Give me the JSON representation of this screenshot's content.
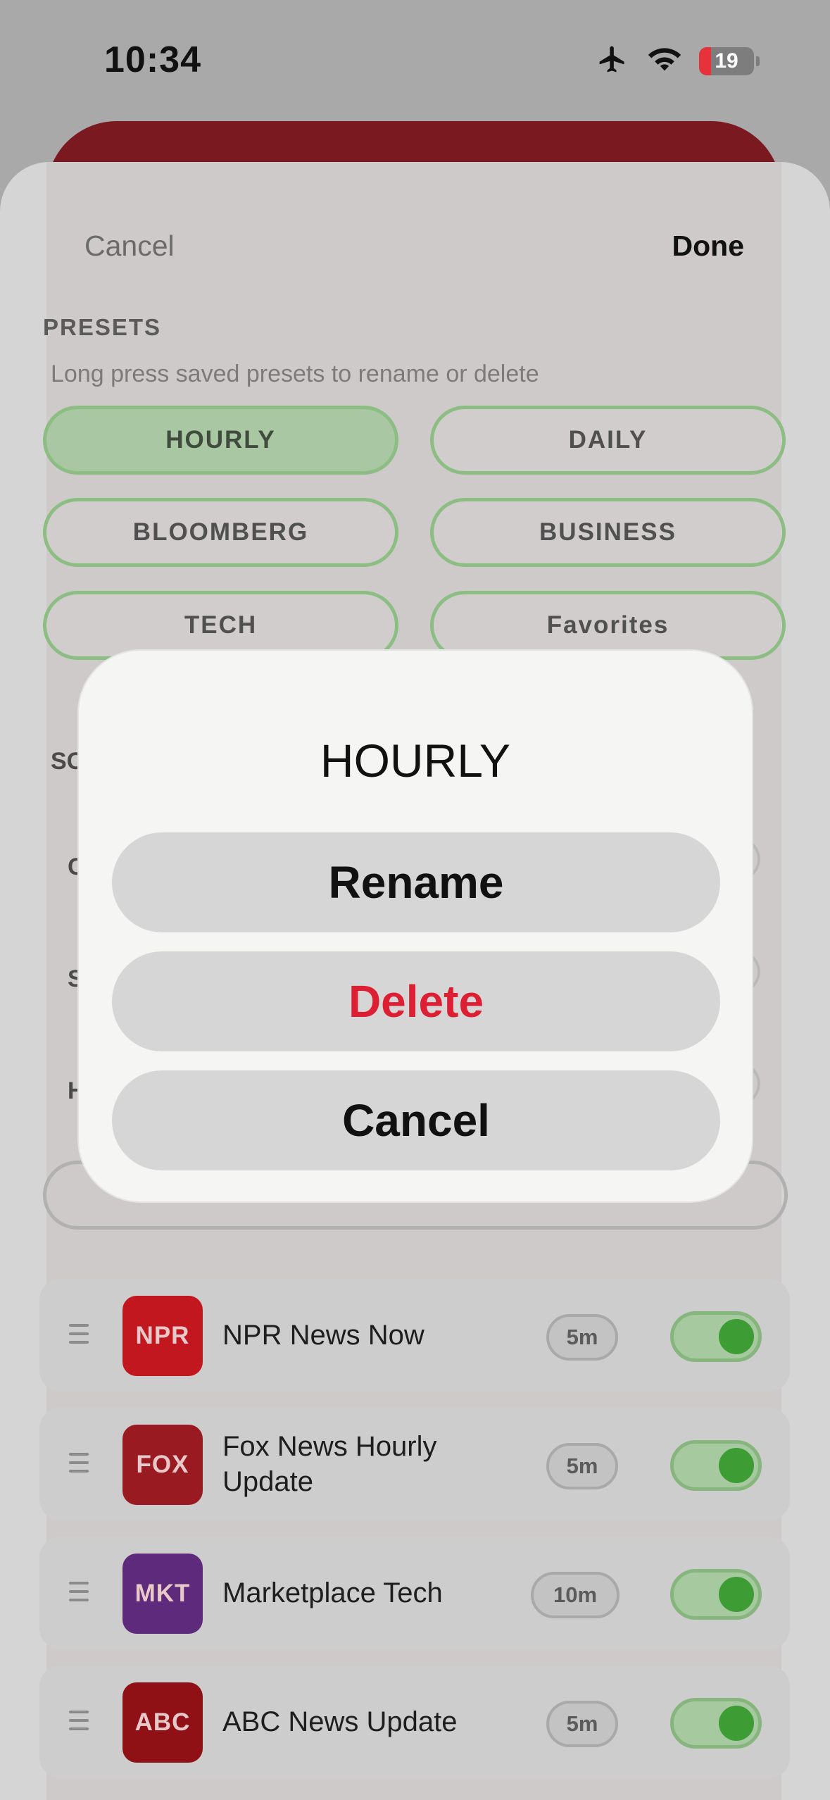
{
  "status_bar": {
    "time": "10:34",
    "battery_level": "19",
    "icons": [
      "airplane-icon",
      "wifi-icon",
      "battery-icon"
    ]
  },
  "header": {
    "cancel_label": "Cancel",
    "done_label": "Done"
  },
  "presets": {
    "section_title": "PRESETS",
    "hint": "Long press saved presets to rename or delete",
    "items": [
      {
        "label": "HOURLY",
        "active": true
      },
      {
        "label": "DAILY",
        "active": false
      },
      {
        "label": "BLOOMBERG",
        "active": false
      },
      {
        "label": "BUSINESS",
        "active": false
      },
      {
        "label": "TECH",
        "active": false
      },
      {
        "label": "Favorites",
        "active": false
      }
    ]
  },
  "obscured": {
    "section_fragment": "SC",
    "row_initials": [
      "C",
      "S",
      "H"
    ]
  },
  "sources": [
    {
      "logo": "NPR",
      "logo_color": "#c2171f",
      "title": "NPR News Now",
      "duration": "5m",
      "enabled": true
    },
    {
      "logo": "FOX",
      "logo_color": "#9a1a22",
      "title": "Fox News Hourly Update",
      "duration": "5m",
      "enabled": true
    },
    {
      "logo": "MKT",
      "logo_color": "#5e2a7c",
      "title": "Marketplace Tech",
      "duration": "10m",
      "enabled": true
    },
    {
      "logo": "ABC",
      "logo_color": "#8f1116",
      "title": "ABC News Update",
      "duration": "5m",
      "enabled": true
    }
  ],
  "dialog": {
    "title": "HOURLY",
    "rename_label": "Rename",
    "delete_label": "Delete",
    "cancel_label": "Cancel",
    "delete_color": "#dd1f33"
  },
  "colors": {
    "accent_green": "#3e9c34",
    "preset_border": "#8cbd83",
    "brand_red": "#7a1920"
  }
}
